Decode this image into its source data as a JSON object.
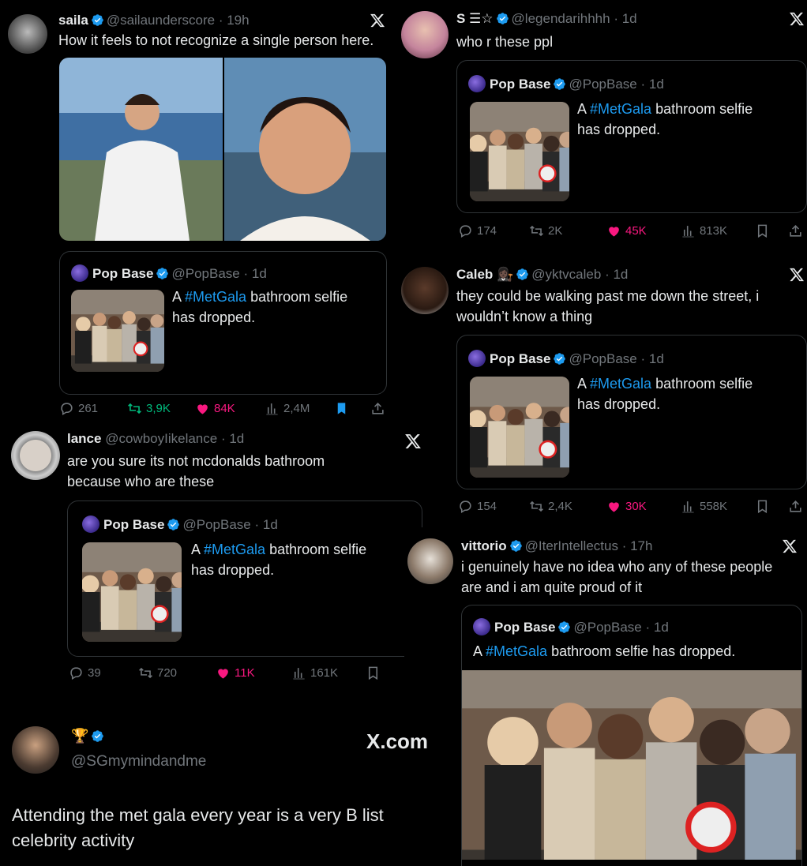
{
  "colors": {
    "accent": "#1d9bf0",
    "like": "#f91880",
    "retweet": "#00ba7c",
    "muted": "#71767b"
  },
  "quoted": {
    "name": "Pop Base",
    "handle": "@PopBase",
    "time": "· 1d",
    "text_pre": "A ",
    "hashtag": "#MetGala",
    "text_line1_post": " bathroom selfie",
    "text_line2": "has dropped.",
    "text_full_post": " bathroom selfie has dropped."
  },
  "tweet_saila": {
    "name": "saila",
    "handle": "@sailaunderscore",
    "time": "· 19h",
    "text": "How it feels to not recognize a single person here.",
    "stats": {
      "replies": "261",
      "retweets": "3,9K",
      "likes": "84K",
      "views": "2,4M"
    }
  },
  "tweet_legend": {
    "name": "S ☰☆",
    "handle": "@legendarihhhh",
    "time": "· 1d",
    "text": "who r these ppl",
    "stats": {
      "replies": "174",
      "retweets": "2K",
      "likes": "45K",
      "views": "813K"
    }
  },
  "tweet_caleb": {
    "name": "Caleb",
    "handle": "@yktvcaleb",
    "time": "· 1d",
    "text_line1": "they could be walking past me down the street, i",
    "text_line2": "wouldn’t know a thing",
    "stats": {
      "replies": "154",
      "retweets": "2,4K",
      "likes": "30K",
      "views": "558K"
    }
  },
  "tweet_lance": {
    "name": "lance",
    "handle": "@cowboyIikelance",
    "time": "· 1d",
    "text_line1": "are you sure its not mcdonalds bathroom",
    "text_line2": "because who are these",
    "stats": {
      "replies": "39",
      "retweets": "720",
      "likes": "11K",
      "views": "161K"
    }
  },
  "tweet_vittorio": {
    "name": "vittorio",
    "handle": "@IterIntellectus",
    "time": "· 17h",
    "text_line1": "i genuinely have no idea who any of these people",
    "text_line2": "are and i am quite proud of it"
  },
  "tweet_sg": {
    "handle": "@SGmymindandme",
    "site": "X.com",
    "text_line1": "Attending the met gala every year is a very B list",
    "text_line2": "celebrity activity"
  }
}
